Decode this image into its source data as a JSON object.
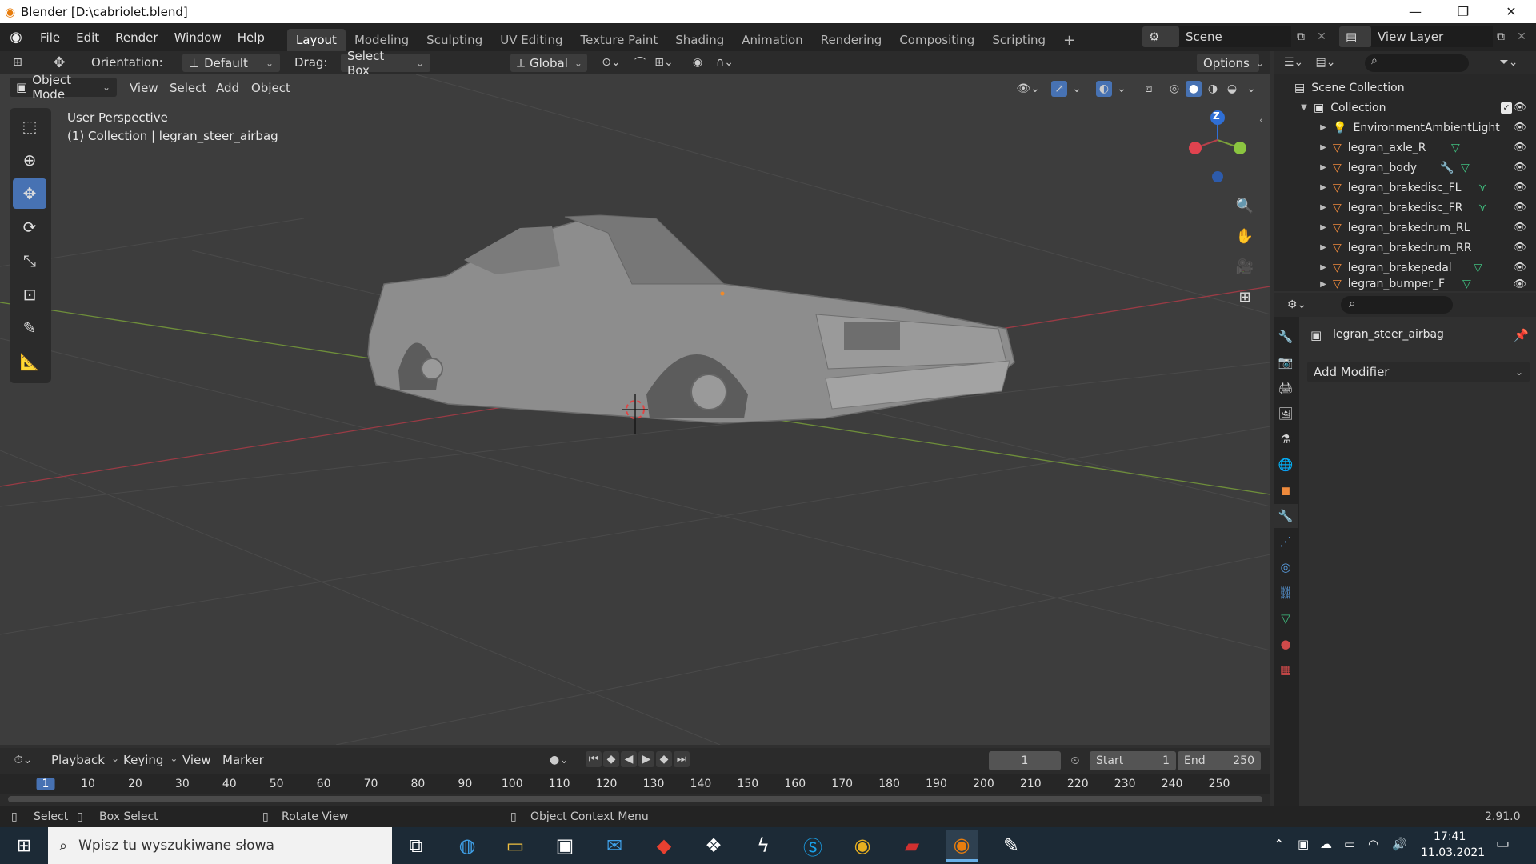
{
  "window": {
    "title": "Blender [D:\\cabriolet.blend]",
    "minimize": "—",
    "maximize": "❐",
    "close": "✕"
  },
  "menus": [
    "File",
    "Edit",
    "Render",
    "Window",
    "Help"
  ],
  "workspaces": [
    "Layout",
    "Modeling",
    "Sculpting",
    "UV Editing",
    "Texture Paint",
    "Shading",
    "Animation",
    "Rendering",
    "Compositing",
    "Scripting"
  ],
  "scene": {
    "label": "Scene"
  },
  "view_layer": {
    "label": "View Layer"
  },
  "tool_header": {
    "orientation_label": "Orientation:",
    "orientation_value": "Default",
    "drag_label": "Drag:",
    "drag_value": "Select Box",
    "transform_value": "Global",
    "options": "Options"
  },
  "viewport_header": {
    "mode": "Object Mode",
    "menus": [
      "View",
      "Select",
      "Add",
      "Object"
    ]
  },
  "viewport": {
    "overlay_line1": "User Perspective",
    "overlay_line2": "(1) Collection | legran_steer_airbag"
  },
  "gizmo": {
    "z": "Z"
  },
  "outliner": {
    "root": "Scene Collection",
    "collection": "Collection",
    "items": [
      {
        "name": "EnvironmentAmbientLight",
        "type": "light"
      },
      {
        "name": "legran_axle_R",
        "type": "mesh"
      },
      {
        "name": "legran_body",
        "type": "mesh"
      },
      {
        "name": "legran_brakedisc_FL",
        "type": "mesh"
      },
      {
        "name": "legran_brakedisc_FR",
        "type": "mesh"
      },
      {
        "name": "legran_brakedrum_RL",
        "type": "mesh"
      },
      {
        "name": "legran_brakedrum_RR",
        "type": "mesh"
      },
      {
        "name": "legran_brakepedal",
        "type": "mesh"
      },
      {
        "name": "legran_bumper_F",
        "type": "mesh"
      }
    ]
  },
  "properties": {
    "object_name": "legran_steer_airbag",
    "add_modifier": "Add Modifier"
  },
  "timeline": {
    "menus": [
      "Playback",
      "Keying",
      "View",
      "Marker"
    ],
    "current_frame": "1",
    "start_label": "Start",
    "start_value": "1",
    "end_label": "End",
    "end_value": "250",
    "ticks": [
      "1",
      "10",
      "20",
      "30",
      "40",
      "50",
      "60",
      "70",
      "80",
      "90",
      "100",
      "110",
      "120",
      "130",
      "140",
      "150",
      "160",
      "170",
      "180",
      "190",
      "200",
      "210",
      "220",
      "230",
      "240",
      "250"
    ]
  },
  "statusbar": {
    "select": "Select",
    "box_select": "Box Select",
    "rotate_view": "Rotate View",
    "context_menu": "Object Context Menu",
    "version": "2.91.0"
  },
  "taskbar": {
    "search_placeholder": "Wpisz tu wyszukiwane słowa",
    "time": "17:41",
    "date": "11.03.2021"
  },
  "colors": {
    "accent": "#4772b3",
    "active_tab": "#3d3d3d",
    "mesh_icon": "#ee8a3c",
    "x_axis": "#b5404a",
    "y_axis": "#7aa03a",
    "z_axis": "#2f6fd6"
  }
}
